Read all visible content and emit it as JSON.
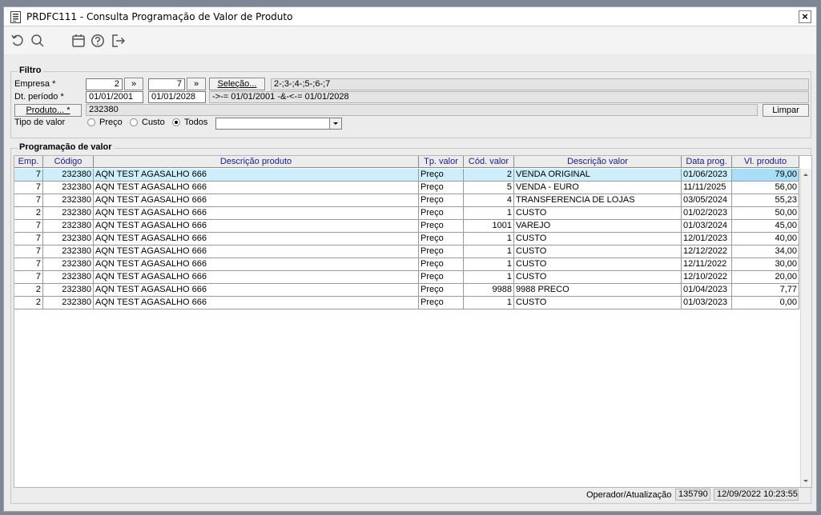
{
  "window": {
    "title": "PRDFC111 - Consulta Programação de Valor de Produto",
    "close_label": "×"
  },
  "toolbar": {
    "icons": [
      "refresh-icon",
      "search-icon",
      "calendar-icon",
      "help-icon",
      "exit-icon"
    ]
  },
  "filter": {
    "title": "Filtro",
    "empresa_label": "Empresa *",
    "empresa_from": "2",
    "empresa_to": "7",
    "empresa_more_label": "»",
    "selecao_label": "Seleção...",
    "selecao_value": "2-;3-;4-;5-;6-;7",
    "periodo_label": "Dt. período *",
    "periodo_from": "01/01/2001",
    "periodo_to": "01/01/2028",
    "periodo_expr": "->-= 01/01/2001 -&-<-= 01/01/2028",
    "produto_button": "Produto... *",
    "produto_value": "232380",
    "limpar_label": "Limpar",
    "tipo_label": "Tipo de valor",
    "tipo_options": [
      "Preço",
      "Custo",
      "Todos"
    ],
    "tipo_selected": "Todos",
    "tipo_combo_value": ""
  },
  "grid": {
    "title": "Programação de valor",
    "columns": [
      "Emp.",
      "Código",
      "Descrição produto",
      "Tp. valor",
      "Cód. valor",
      "Descrição valor",
      "Data prog.",
      "Vl. produto"
    ],
    "rows": [
      [
        "7",
        "232380",
        "AQN TEST AGASALHO 666",
        "Preço",
        "2",
        "VENDA ORIGINAL",
        "01/06/2023",
        "79,00"
      ],
      [
        "7",
        "232380",
        "AQN TEST AGASALHO 666",
        "Preço",
        "5",
        "VENDA - EURO",
        "11/11/2025",
        "56,00"
      ],
      [
        "7",
        "232380",
        "AQN TEST AGASALHO 666",
        "Preço",
        "4",
        "TRANSFERENCIA DE LOJAS",
        "03/05/2024",
        "55,23"
      ],
      [
        "2",
        "232380",
        "AQN TEST AGASALHO 666",
        "Preço",
        "1",
        "CUSTO",
        "01/02/2023",
        "50,00"
      ],
      [
        "7",
        "232380",
        "AQN TEST AGASALHO 666",
        "Preço",
        "1001",
        "VAREJO",
        "01/03/2024",
        "45,00"
      ],
      [
        "7",
        "232380",
        "AQN TEST AGASALHO 666",
        "Preço",
        "1",
        "CUSTO",
        "12/01/2023",
        "40,00"
      ],
      [
        "7",
        "232380",
        "AQN TEST AGASALHO 666",
        "Preço",
        "1",
        "CUSTO",
        "12/12/2022",
        "34,00"
      ],
      [
        "7",
        "232380",
        "AQN TEST AGASALHO 666",
        "Preço",
        "1",
        "CUSTO",
        "12/11/2022",
        "30,00"
      ],
      [
        "7",
        "232380",
        "AQN TEST AGASALHO 666",
        "Preço",
        "1",
        "CUSTO",
        "12/10/2022",
        "20,00"
      ],
      [
        "2",
        "232380",
        "AQN TEST AGASALHO 666",
        "Preço",
        "9988",
        "9988 PRECO",
        "01/04/2023",
        "7,77"
      ],
      [
        "2",
        "232380",
        "AQN TEST AGASALHO 666",
        "Preço",
        "1",
        "CUSTO",
        "01/03/2023",
        "0,00"
      ]
    ]
  },
  "status": {
    "label": "Operador/Atualização",
    "operator": "135790",
    "timestamp": "12/09/2022 10:23:55"
  }
}
